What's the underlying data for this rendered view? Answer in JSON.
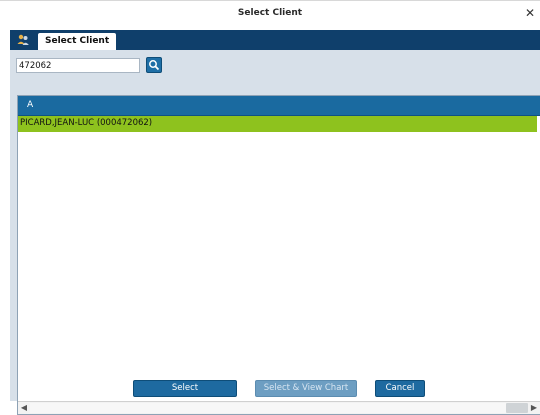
{
  "window": {
    "title": "Select Client",
    "close_icon": "close-icon"
  },
  "tabs": [
    {
      "label": "Select Client",
      "icon": "client-group-icon",
      "active": true
    }
  ],
  "search": {
    "value": "472062",
    "button_icon": "search-icon"
  },
  "list": {
    "header": "A",
    "rows": [
      {
        "label": "PICARD,JEAN-LUC (000472062)",
        "selected": true
      }
    ]
  },
  "buttons": {
    "select_label": "Select",
    "view_chart_label": "Select & View Chart",
    "cancel_label": "Cancel"
  },
  "colors": {
    "accent": "#1e6aa0",
    "tab_bar": "#0f3f6b",
    "selected_row": "#8ec21e",
    "content_bg": "#d7e0e9"
  }
}
